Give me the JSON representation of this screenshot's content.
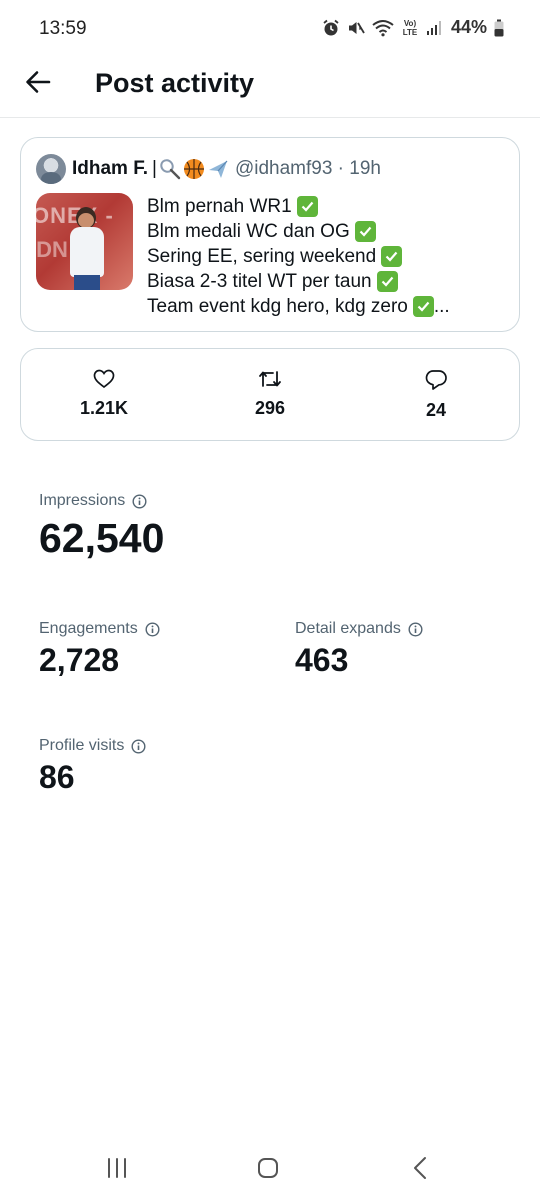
{
  "status_bar": {
    "time": "13:59",
    "battery": "44%",
    "icons": [
      "alarm-icon",
      "mute-icon",
      "wifi-icon",
      "volte-icon",
      "signal-icon",
      "battery-icon"
    ],
    "volte_label": "Vo) LTE"
  },
  "header": {
    "title": "Post activity",
    "back_icon": "arrow-left-icon"
  },
  "post": {
    "author_name": "Idham F.",
    "separator": "|",
    "emojis": [
      "badminton-icon",
      "basketball-icon",
      "airplane-icon"
    ],
    "meta": "@idhamf93 · 19h",
    "lines": [
      "Blm pernah WR1",
      "Blm medali WC dan OG",
      "Sering EE, sering weekend",
      "Biasa 2-3 titel WT per taun",
      "Team event kdg hero, kdg zero"
    ],
    "ellipsis": "...",
    "thumbnail_text": [
      "ONEX -",
      "IDN DI"
    ]
  },
  "engagement": {
    "likes": "1.21K",
    "reposts": "296",
    "replies": "24"
  },
  "metrics": {
    "impressions_label": "Impressions",
    "impressions_value": "62,540",
    "engagements_label": "Engagements",
    "engagements_value": "2,728",
    "detail_expands_label": "Detail expands",
    "detail_expands_value": "463",
    "profile_visits_label": "Profile visits",
    "profile_visits_value": "86"
  },
  "colors": {
    "text_primary": "#0f1419",
    "text_secondary": "#536471",
    "border": "#cfd9de",
    "check_green": "#5fb53a"
  }
}
